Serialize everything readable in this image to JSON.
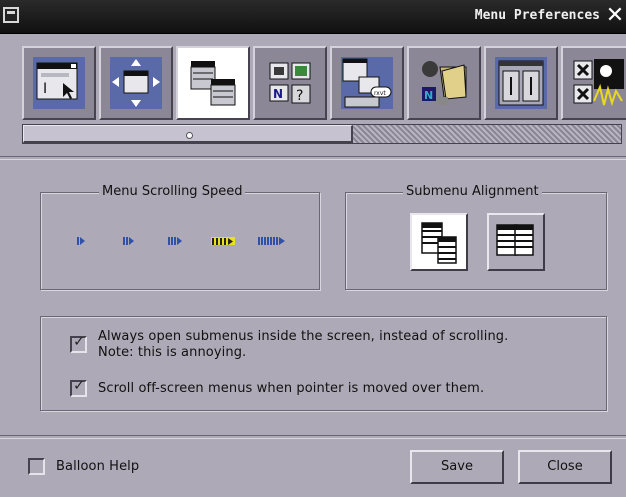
{
  "window": {
    "title": "Menu Preferences"
  },
  "toolbar": {
    "icons": [
      "window-focus-icon",
      "window-placement-icon",
      "menu-preferences-icon",
      "icon-preferences-icon",
      "workspace-icon",
      "file-manager-icon",
      "miscellaneous-icon",
      "special-effects-icon"
    ],
    "selected_index": 2
  },
  "scrolling_speed": {
    "title": "Menu Scrolling Speed",
    "levels": 5,
    "selected_level": 4,
    "arrow_color": "#3350a8",
    "selected_color": "#e8e020"
  },
  "submenu_alignment": {
    "title": "Submenu Alignment",
    "options": [
      "submenu-align-top-icon",
      "submenu-align-bottom-icon"
    ],
    "selected_index": 0
  },
  "options": {
    "open_inside_screen": {
      "line1": "Always open submenus inside the screen, instead of scrolling.",
      "line2": "Note: this is annoying.",
      "checked": true
    },
    "scroll_offscreen": {
      "label": "Scroll off-screen menus when pointer is moved over them.",
      "checked": true
    }
  },
  "footer": {
    "balloon_help": {
      "label": "Balloon Help",
      "checked": false
    },
    "save_label": "Save",
    "close_label": "Close"
  }
}
